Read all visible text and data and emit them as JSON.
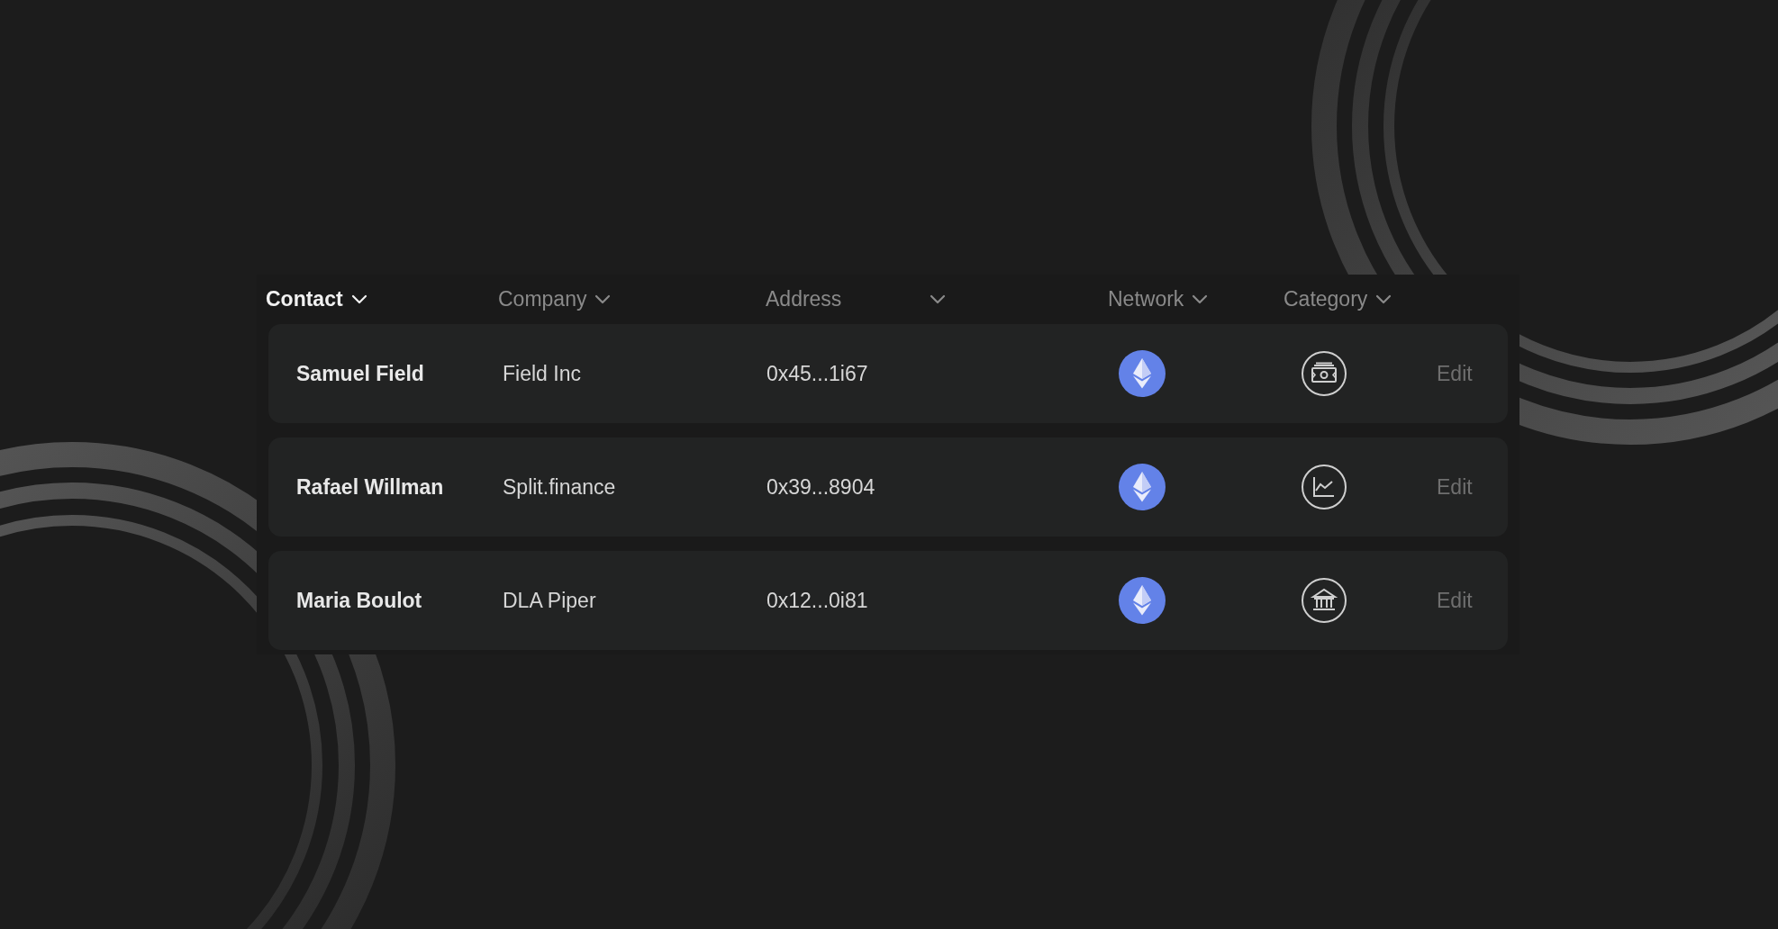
{
  "table": {
    "columns": [
      {
        "label": "Contact",
        "selected": true
      },
      {
        "label": "Company",
        "selected": false
      },
      {
        "label": "Address",
        "selected": false
      },
      {
        "label": "Network",
        "selected": false
      },
      {
        "label": "Category",
        "selected": false
      }
    ],
    "rows": [
      {
        "contact": "Samuel Field",
        "company": "Field Inc",
        "address": "0x45...1i67",
        "network": {
          "kind": "ethereum"
        },
        "category": {
          "kind": "cash"
        },
        "action": "Edit"
      },
      {
        "contact": "Rafael Willman",
        "company": "Split.finance",
        "address": "0x39...8904",
        "network": {
          "kind": "ethereum"
        },
        "category": {
          "kind": "chart"
        },
        "action": "Edit"
      },
      {
        "contact": "Maria Boulot",
        "company": "DLA Piper",
        "address": "0x12...0i81",
        "network": {
          "kind": "ethereum"
        },
        "category": {
          "kind": "bank"
        },
        "action": "Edit"
      }
    ]
  }
}
